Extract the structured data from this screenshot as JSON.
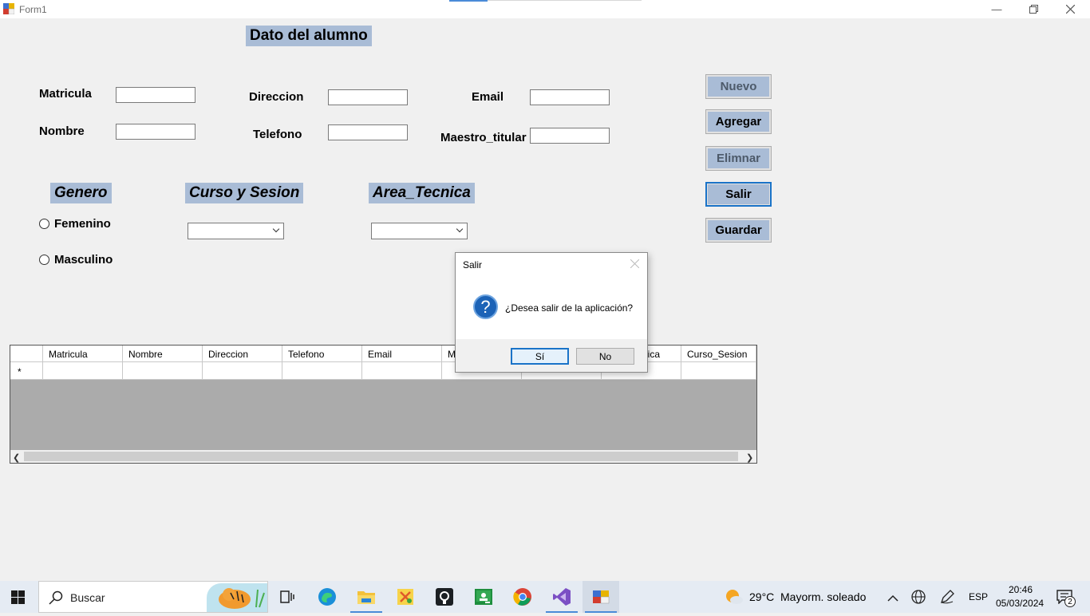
{
  "window": {
    "title": "Form1",
    "controls": [
      "minimize",
      "restore",
      "close"
    ]
  },
  "form": {
    "heading": "Dato del alumno",
    "fields": {
      "matricula": {
        "label": "Matricula",
        "value": ""
      },
      "nombre": {
        "label": "Nombre",
        "value": ""
      },
      "direccion": {
        "label": "Direccion",
        "value": ""
      },
      "telefono": {
        "label": "Telefono",
        "value": ""
      },
      "email": {
        "label": "Email",
        "value": ""
      },
      "maestro_titular": {
        "label": "Maestro_titular",
        "value": ""
      }
    },
    "sections": {
      "genero": "Genero",
      "curso_sesion": "Curso y Sesion",
      "area_tecnica": "Area_Tecnica"
    },
    "radios": {
      "femenino": "Femenino",
      "masculino": "Masculino"
    },
    "combos": {
      "curso_sesion_value": "",
      "area_tecnica_value": ""
    },
    "buttons": {
      "nuevo": "Nuevo",
      "agregar": "Agregar",
      "eliminar": "Elimnar",
      "salir": "Salir",
      "guardar": "Guardar"
    }
  },
  "grid": {
    "columns": [
      "Matricula",
      "Nombre",
      "Direccion",
      "Telefono",
      "Email",
      "Ma",
      "",
      "nica",
      "Curso_Sesion"
    ],
    "new_row_marker": "*"
  },
  "dialog": {
    "title": "Salir",
    "message": "¿Desea salir de la aplicación?",
    "icon": "question-icon",
    "yes": "Sí",
    "no": "No"
  },
  "taskbar": {
    "search_placeholder": "Buscar",
    "apps": [
      "task-view",
      "edge",
      "file-explorer",
      "app-xyz",
      "github-desktop",
      "google-classroom",
      "chrome",
      "visual-studio",
      "winforms-app"
    ],
    "weather": {
      "temp": "29°C",
      "desc": "Mayorm. soleado"
    },
    "lang": "ESP",
    "time": "20:46",
    "date": "05/03/2024",
    "notif_count": "2"
  },
  "colors": {
    "label_bg": "#a9bcd6",
    "accent": "#1a73c8",
    "grid_bg": "#ababab"
  }
}
